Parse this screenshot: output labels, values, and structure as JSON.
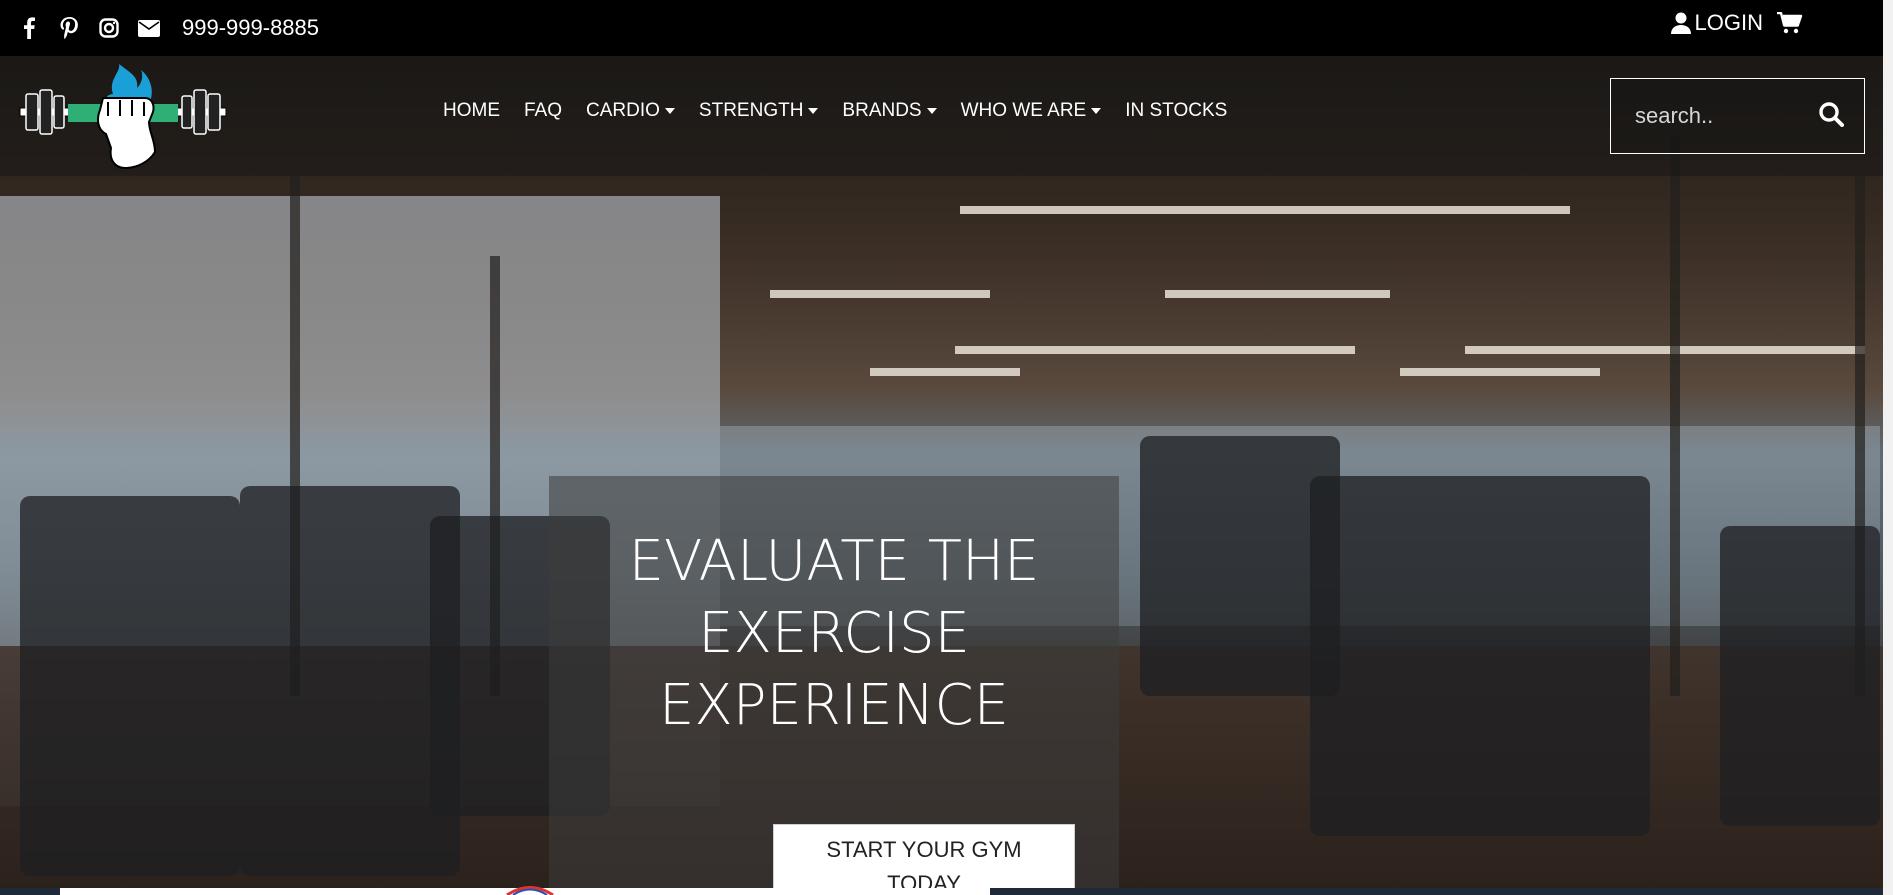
{
  "topbar": {
    "phone": "999-999-8885",
    "login_label": "LOGIN",
    "icons": [
      "facebook-icon",
      "pinterest-icon",
      "instagram-icon",
      "envelope-icon",
      "user-icon",
      "cart-icon"
    ]
  },
  "nav": {
    "items": [
      {
        "label": "HOME",
        "dropdown": false
      },
      {
        "label": "FAQ",
        "dropdown": false
      },
      {
        "label": "CARDIO",
        "dropdown": true
      },
      {
        "label": "STRENGTH",
        "dropdown": true
      },
      {
        "label": "BRANDS",
        "dropdown": true
      },
      {
        "label": "WHO WE ARE",
        "dropdown": true
      },
      {
        "label": "IN STOCKS",
        "dropdown": false
      }
    ]
  },
  "search": {
    "placeholder": "search.."
  },
  "hero": {
    "headline_line1": "EVALUATE THE",
    "headline_line2": "EXERCISE",
    "headline_line3": "EXPERIENCE",
    "cta_line1": "START YOUR GYM",
    "cta_line2": "TODAY"
  },
  "colors": {
    "topbar": "#000000",
    "text": "#ffffff",
    "cta_bg": "#ffffff"
  }
}
